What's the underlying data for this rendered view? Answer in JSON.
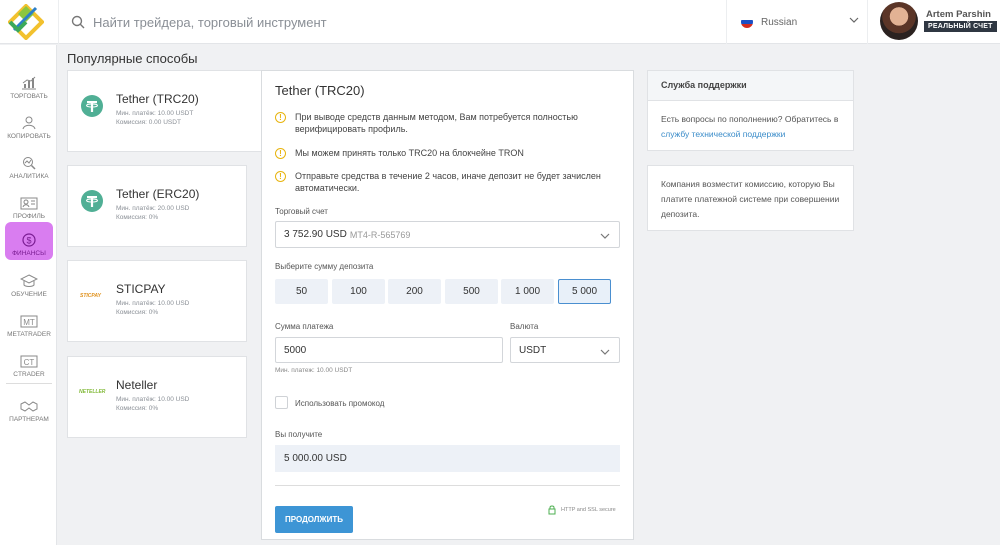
{
  "header": {
    "search_placeholder": "Найти трейдера, торговый инструмент",
    "language": "Russian",
    "user_name": "Artem Parshin",
    "account_badge": "РЕАЛЬНЫЙ СЧЕТ"
  },
  "sidebar": {
    "items": [
      {
        "label": "ТОРГОВАТЬ",
        "icon": "chart-icon"
      },
      {
        "label": "КОПИРОВАТЬ",
        "icon": "copy-traders-icon"
      },
      {
        "label": "АНАЛИТИКА",
        "icon": "analytics-icon"
      },
      {
        "label": "ПРОФИЛЬ",
        "icon": "profile-card-icon"
      },
      {
        "label": "ФИНАНСЫ",
        "icon": "dollar-icon",
        "active": true
      },
      {
        "label": "ОБУЧЕНИЕ",
        "icon": "graduation-cap-icon"
      },
      {
        "label": "METATRADER",
        "icon": "mt-icon",
        "badge": "MT"
      },
      {
        "label": "CTRADER",
        "icon": "ct-icon",
        "badge": "CT"
      },
      {
        "label": "ПАРТНЕРАМ",
        "icon": "handshake-icon"
      }
    ]
  },
  "section_title": "Популярные способы",
  "methods": [
    {
      "name": "Tether (TRC20)",
      "min": "Мин. платёж: 10.00 USDT",
      "fee": "Комиссия: 0.00 USDT",
      "logo": "tether-icon"
    },
    {
      "name": "Tether (ERC20)",
      "min": "Мин. платёж: 20.00 USD",
      "fee": "Комиссия: 0%",
      "logo": "tether-icon"
    },
    {
      "name": "STICPAY",
      "min": "Мин. платёж: 10.00 USD",
      "fee": "Комиссия: 0%",
      "logo_text": "STICPAY"
    },
    {
      "name": "Neteller",
      "min": "Мин. платёж: 10.00 USD",
      "fee": "Комиссия: 0%",
      "logo_text": "NETELLER"
    }
  ],
  "form": {
    "title": "Tether (TRC20)",
    "warnings": [
      "При выводе средств данным методом, Вам потребуется полностью верифицировать профиль.",
      "Мы можем принять только TRC20 на блокчейне TRON",
      "Отправьте средства в течение 2 часов, иначе депозит не будет зачислен автоматически."
    ],
    "account_label": "Торговый счет",
    "account_value": "3 752.90 USD",
    "account_id": "MT4-R-565769",
    "amount_label": "Выберите сумму депозита",
    "amounts": [
      "50",
      "100",
      "200",
      "500",
      "1 000",
      "5 000"
    ],
    "selected_amount": "5 000",
    "sum_label": "Сумма платежа",
    "sum_value": "5000",
    "currency_label": "Валюта",
    "currency_value": "USDT",
    "min_hint": "Мин. платеж: 10.00 USDT",
    "promo_label": "Использовать промокод",
    "receive_label": "Вы получите",
    "receive_value": "5 000.00 USD",
    "submit_label": "ПРОДОЛЖИТЬ",
    "secure_label": "HTTP and SSL secure"
  },
  "support": {
    "title": "Служба поддержки",
    "text": "Есть вопросы по пополнению? Обратитесь в",
    "link": "службу технической поддержки",
    "commission_note": "Компания возместит комиссию, которую Вы платите платежной системе при совершении депозита."
  },
  "colors": {
    "accent": "#3d95d5",
    "active_nav": "#d97df0",
    "tether": "#50af95",
    "warning": "#e8b40f"
  }
}
